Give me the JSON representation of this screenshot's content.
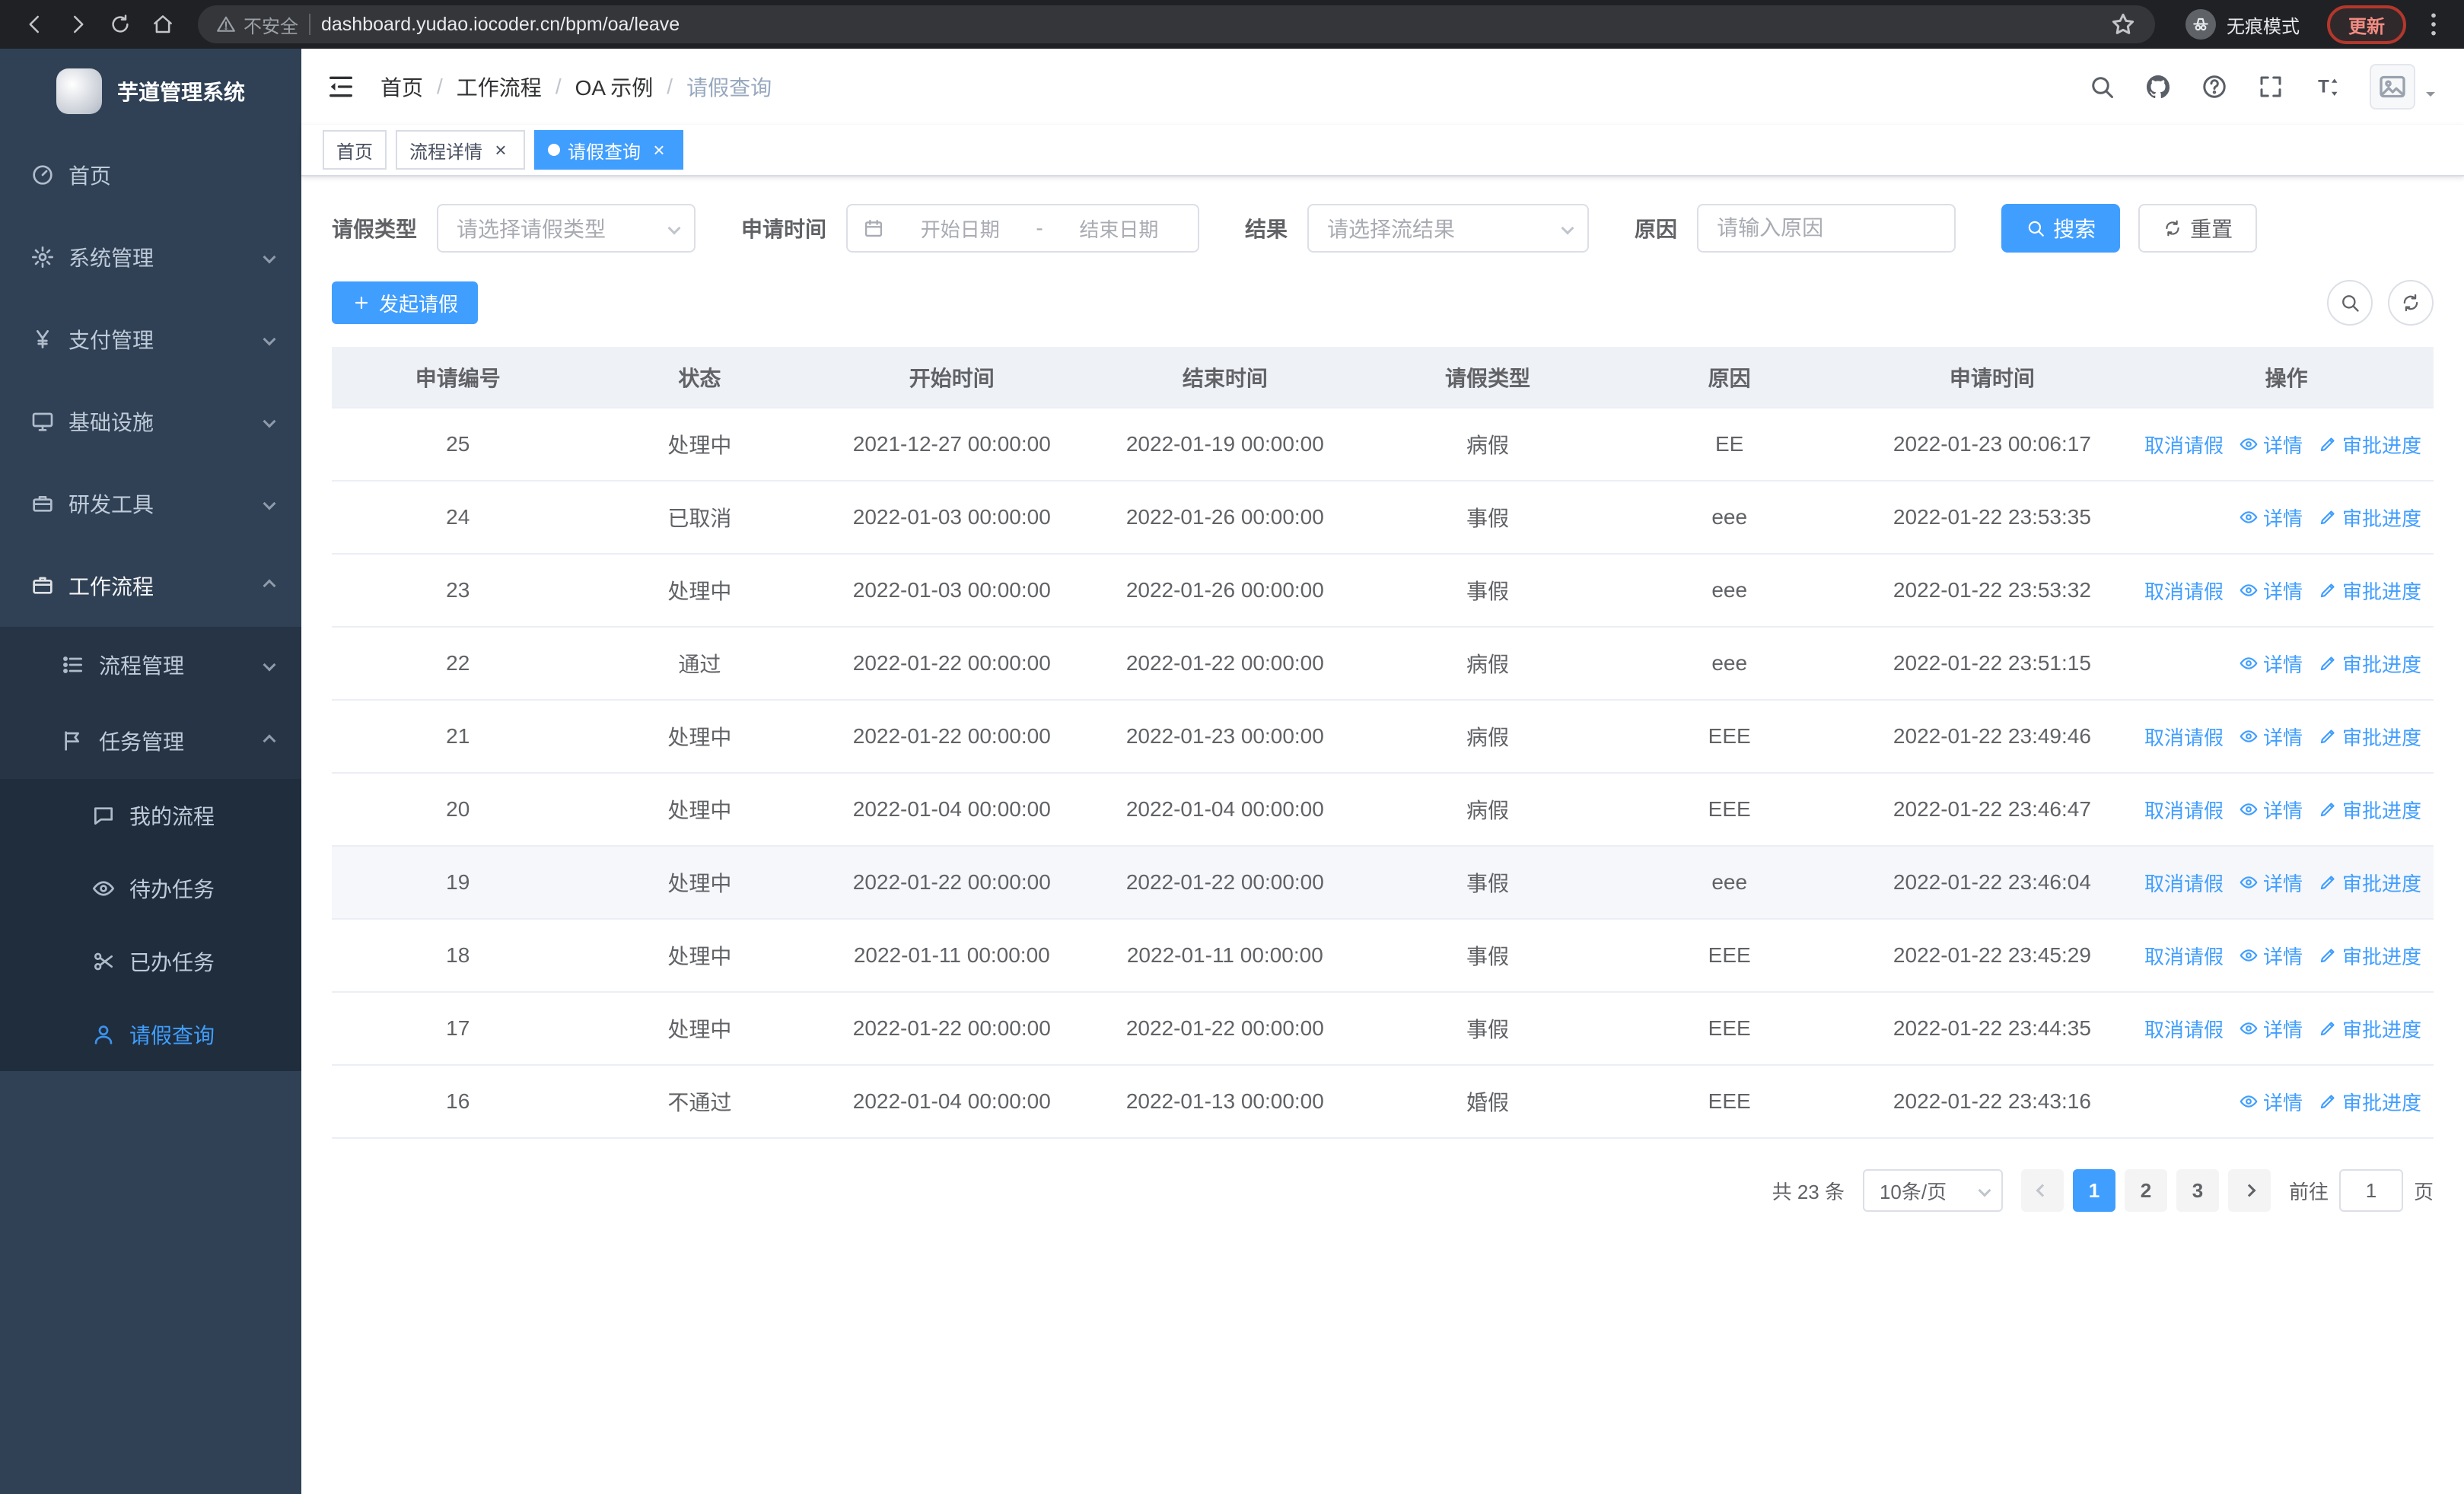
{
  "browser": {
    "security_warning": "不安全",
    "url": "dashboard.yudao.iocoder.cn/bpm/oa/leave",
    "incognito_label": "无痕模式",
    "update_label": "更新"
  },
  "sidebar": {
    "title": "芋道管理系统",
    "menu": [
      {
        "label": "首页",
        "icon": "dashboard"
      },
      {
        "label": "系统管理",
        "icon": "gear",
        "expandable": true,
        "expanded": false
      },
      {
        "label": "支付管理",
        "icon": "yen",
        "expandable": true,
        "expanded": false
      },
      {
        "label": "基础设施",
        "icon": "infra",
        "expandable": true,
        "expanded": false
      },
      {
        "label": "研发工具",
        "icon": "tools",
        "expandable": true,
        "expanded": false
      },
      {
        "label": "工作流程",
        "icon": "workflow",
        "expandable": true,
        "expanded": true,
        "highlight": true,
        "children": [
          {
            "label": "流程管理",
            "icon": "process",
            "expandable": true,
            "expanded": false
          },
          {
            "label": "任务管理",
            "icon": "task",
            "expandable": true,
            "expanded": true,
            "children": [
              {
                "label": "我的流程",
                "icon": "chat"
              },
              {
                "label": "待办任务",
                "icon": "eye"
              },
              {
                "label": "已办任务",
                "icon": "scissors"
              },
              {
                "label": "请假查询",
                "icon": "user",
                "active": true
              }
            ]
          }
        ]
      }
    ]
  },
  "header": {
    "breadcrumb": [
      "首页",
      "工作流程",
      "OA 示例",
      "请假查询"
    ]
  },
  "tags": [
    {
      "label": "首页",
      "closable": false,
      "active": false
    },
    {
      "label": "流程详情",
      "closable": true,
      "active": false
    },
    {
      "label": "请假查询",
      "closable": true,
      "active": true
    }
  ],
  "filters": {
    "leave_type_label": "请假类型",
    "leave_type_placeholder": "请选择请假类型",
    "apply_time_label": "申请时间",
    "date_start_placeholder": "开始日期",
    "date_separator": "-",
    "date_end_placeholder": "结束日期",
    "result_label": "结果",
    "result_placeholder": "请选择流结果",
    "reason_label": "原因",
    "reason_placeholder": "请输入原因",
    "search_button": "搜索",
    "reset_button": "重置"
  },
  "toolbar": {
    "create_button": "发起请假"
  },
  "table": {
    "columns": [
      "申请编号",
      "状态",
      "开始时间",
      "结束时间",
      "请假类型",
      "原因",
      "申请时间",
      "操作"
    ],
    "action_labels": {
      "cancel": "取消请假",
      "detail": "详情",
      "progress": "审批进度"
    },
    "rows": [
      {
        "id": "25",
        "status": "处理中",
        "start": "2021-12-27 00:00:00",
        "end": "2022-01-19 00:00:00",
        "type": "病假",
        "reason": "EE",
        "apply": "2022-01-23 00:06:17",
        "actions": [
          "cancel",
          "detail",
          "progress"
        ],
        "hovered": false
      },
      {
        "id": "24",
        "status": "已取消",
        "start": "2022-01-03 00:00:00",
        "end": "2022-01-26 00:00:00",
        "type": "事假",
        "reason": "eee",
        "apply": "2022-01-22 23:53:35",
        "actions": [
          "detail",
          "progress"
        ],
        "hovered": false
      },
      {
        "id": "23",
        "status": "处理中",
        "start": "2022-01-03 00:00:00",
        "end": "2022-01-26 00:00:00",
        "type": "事假",
        "reason": "eee",
        "apply": "2022-01-22 23:53:32",
        "actions": [
          "cancel",
          "detail",
          "progress"
        ],
        "hovered": false
      },
      {
        "id": "22",
        "status": "通过",
        "start": "2022-01-22 00:00:00",
        "end": "2022-01-22 00:00:00",
        "type": "病假",
        "reason": "eee",
        "apply": "2022-01-22 23:51:15",
        "actions": [
          "detail",
          "progress"
        ],
        "hovered": false
      },
      {
        "id": "21",
        "status": "处理中",
        "start": "2022-01-22 00:00:00",
        "end": "2022-01-23 00:00:00",
        "type": "病假",
        "reason": "EEE",
        "apply": "2022-01-22 23:49:46",
        "actions": [
          "cancel",
          "detail",
          "progress"
        ],
        "hovered": false
      },
      {
        "id": "20",
        "status": "处理中",
        "start": "2022-01-04 00:00:00",
        "end": "2022-01-04 00:00:00",
        "type": "病假",
        "reason": "EEE",
        "apply": "2022-01-22 23:46:47",
        "actions": [
          "cancel",
          "detail",
          "progress"
        ],
        "hovered": false
      },
      {
        "id": "19",
        "status": "处理中",
        "start": "2022-01-22 00:00:00",
        "end": "2022-01-22 00:00:00",
        "type": "事假",
        "reason": "eee",
        "apply": "2022-01-22 23:46:04",
        "actions": [
          "cancel",
          "detail",
          "progress"
        ],
        "hovered": true
      },
      {
        "id": "18",
        "status": "处理中",
        "start": "2022-01-11 00:00:00",
        "end": "2022-01-11 00:00:00",
        "type": "事假",
        "reason": "EEE",
        "apply": "2022-01-22 23:45:29",
        "actions": [
          "cancel",
          "detail",
          "progress"
        ],
        "hovered": false
      },
      {
        "id": "17",
        "status": "处理中",
        "start": "2022-01-22 00:00:00",
        "end": "2022-01-22 00:00:00",
        "type": "事假",
        "reason": "EEE",
        "apply": "2022-01-22 23:44:35",
        "actions": [
          "cancel",
          "detail",
          "progress"
        ],
        "hovered": false
      },
      {
        "id": "16",
        "status": "不通过",
        "start": "2022-01-04 00:00:00",
        "end": "2022-01-13 00:00:00",
        "type": "婚假",
        "reason": "EEE",
        "apply": "2022-01-22 23:43:16",
        "actions": [
          "detail",
          "progress"
        ],
        "hovered": false
      }
    ]
  },
  "pagination": {
    "total": "共 23 条",
    "page_size": "10条/页",
    "pages": [
      "1",
      "2",
      "3"
    ],
    "current_page": "1",
    "goto_label": "前往",
    "goto_value": "1",
    "goto_suffix": "页"
  },
  "colors": {
    "primary": "#409eff",
    "chrome_bg": "#202124",
    "urlbar_bg": "#35363a",
    "sidebar_bg": "#304156",
    "submenu_bg": "#263445",
    "submenu_deep_bg": "#1f2d3d",
    "sidebar_text": "#bfcbd9",
    "border": "#dcdfe6",
    "row_border": "#ebeef5",
    "table_header_bg": "#eef1f6",
    "hover_row": "#f5f7fa",
    "pager_bg": "#f4f4f5"
  }
}
